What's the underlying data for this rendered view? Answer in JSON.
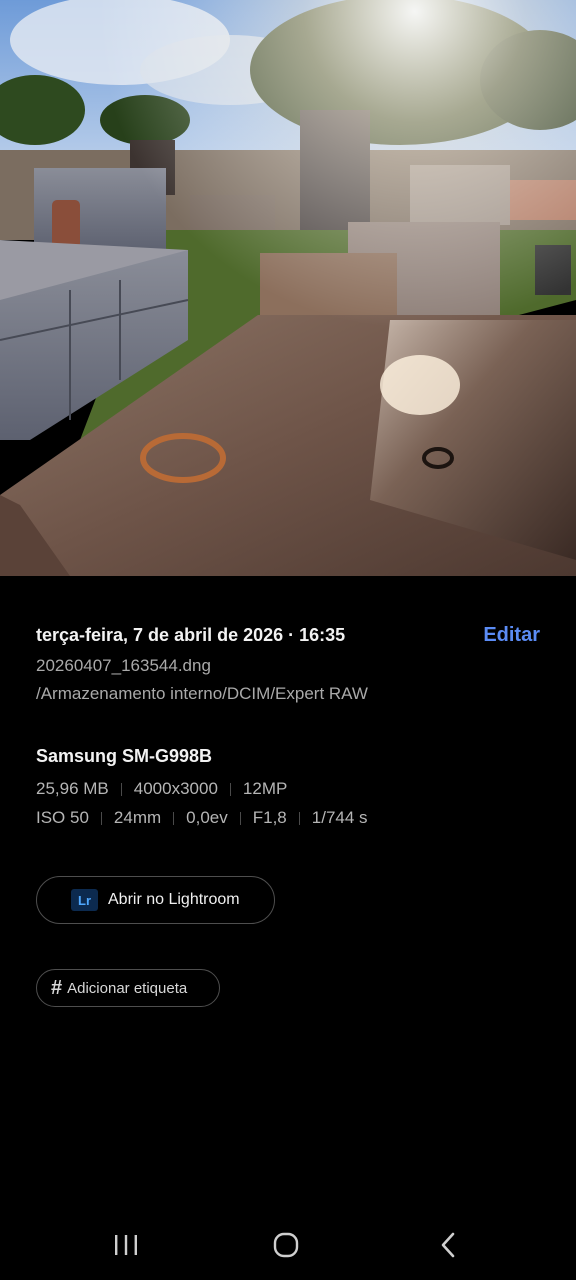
{
  "photo": {
    "icon": "photo-cemetery-graves"
  },
  "details": {
    "date": "terça-feira, 7 de abril de 2026 · 16:35",
    "edit_label": "Editar",
    "filename": "20260407_163544.dng",
    "filepath": "/Armazenamento interno/DCIM/Expert RAW",
    "device": "Samsung SM-G998B",
    "specs_row1": [
      "25,96 MB",
      "4000x3000",
      "12MP"
    ],
    "specs_row2": [
      "ISO 50",
      "24mm",
      "0,0ev",
      "F1,8",
      "1/744 s"
    ]
  },
  "actions": {
    "lightroom_icon_text": "Lr",
    "lightroom_label": "Abrir no Lightroom",
    "tag_symbol": "#",
    "tag_label": "Adicionar etiqueta"
  },
  "navbar": {
    "recent_icon": "recent-apps-icon",
    "home_icon": "home-icon",
    "back_icon": "back-icon"
  },
  "colors": {
    "accent": "#5b8cf5",
    "background": "#000000",
    "secondary_text": "#a9a9a9"
  }
}
